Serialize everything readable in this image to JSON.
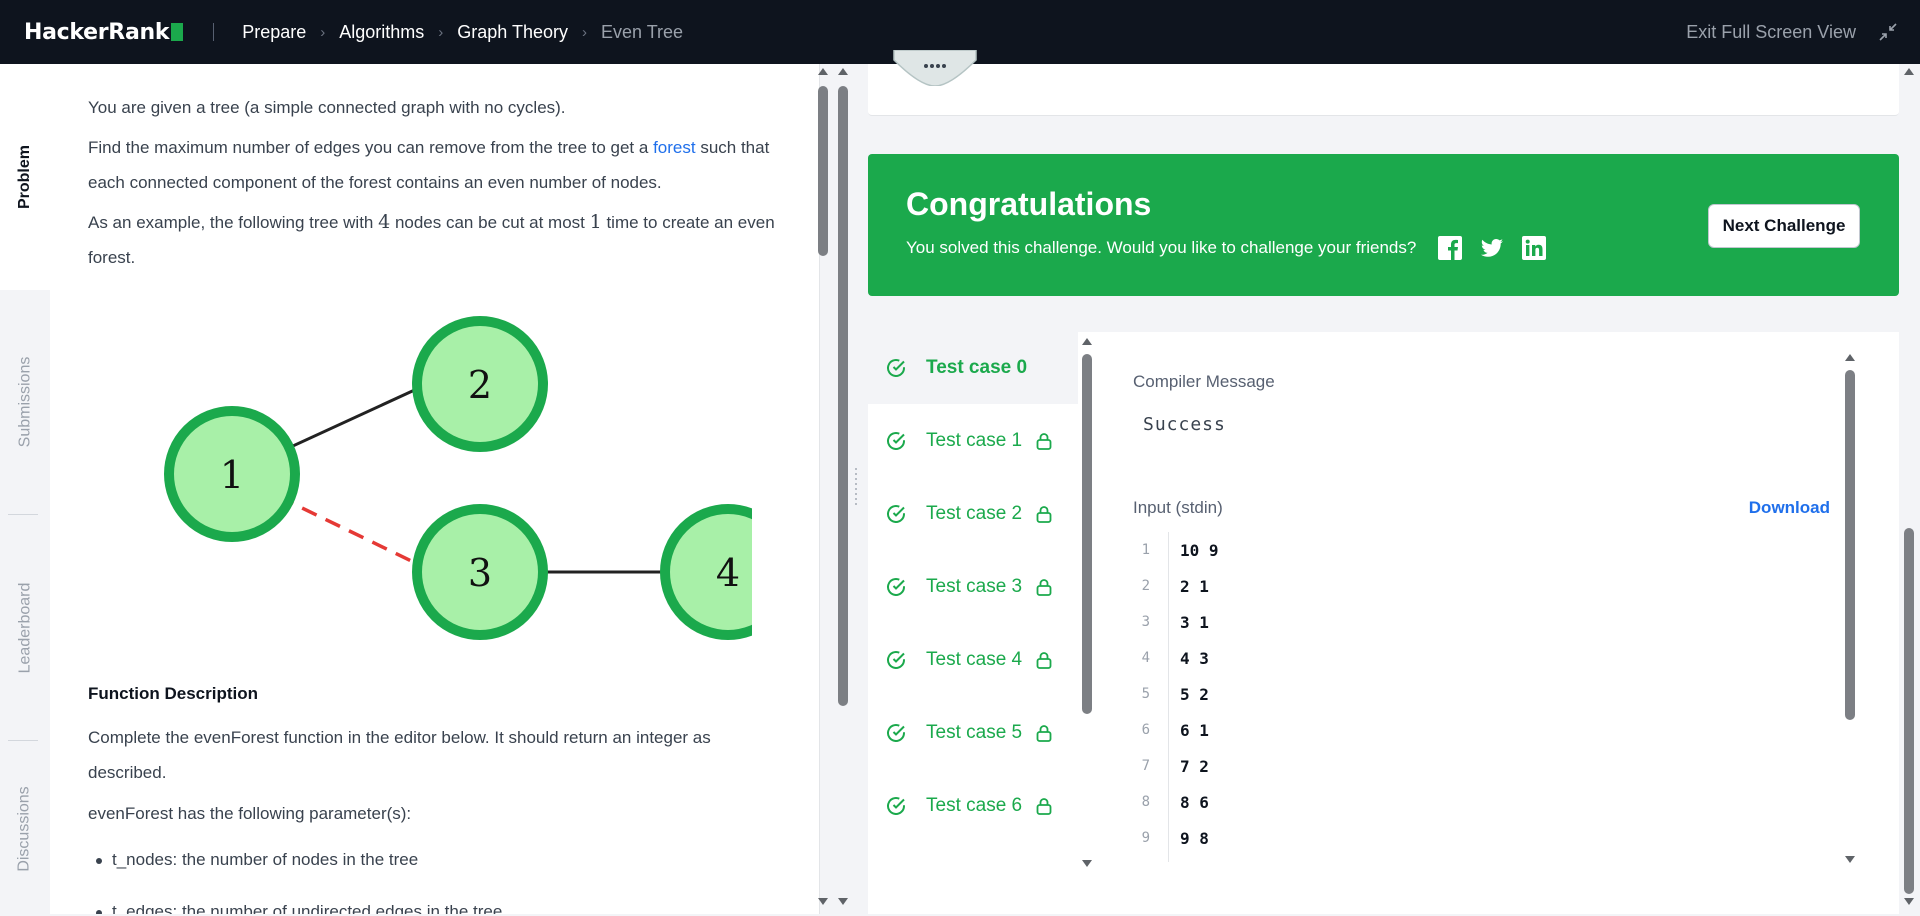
{
  "header": {
    "logo_text": "HackerRank",
    "breadcrumbs": [
      "Prepare",
      "Algorithms",
      "Graph Theory",
      "Even Tree"
    ],
    "exit_label": "Exit Full Screen View"
  },
  "tabs": [
    "Problem",
    "Submissions",
    "Leaderboard",
    "Discussions"
  ],
  "problem": {
    "intro": "You are given a tree (a simple connected graph with no cycles).",
    "p2_before": "Find the maximum number of edges you can remove from the tree to get a",
    "p2_link": "forest",
    "p2_after": "such that each connected component of the forest contains an even number of nodes.",
    "p3_a": "As an example, the following tree with",
    "p3_n1": "4",
    "p3_b": "nodes can be cut at most",
    "p3_n2": "1",
    "p3_c": "time to create an even forest.",
    "tree_nodes": [
      "1",
      "2",
      "3",
      "4"
    ],
    "fd_title": "Function Description",
    "fd_text": "Complete the evenForest function in the editor below. It should return an integer as described.",
    "params_intro": "evenForest has the following parameter(s):",
    "params": [
      "t_nodes: the number of nodes in the tree",
      "t_edges: the number of undirected edges in the tree"
    ]
  },
  "congrats": {
    "title": "Congratulations",
    "subtitle": "You solved this challenge. Would you like to challenge your friends?",
    "next_button": "Next Challenge",
    "share_icons": [
      "facebook-icon",
      "twitter-icon",
      "linkedin-icon"
    ]
  },
  "results": {
    "test_cases": [
      {
        "label": "Test case 0",
        "locked": false,
        "active": true
      },
      {
        "label": "Test case 1",
        "locked": true
      },
      {
        "label": "Test case 2",
        "locked": true
      },
      {
        "label": "Test case 3",
        "locked": true
      },
      {
        "label": "Test case 4",
        "locked": true
      },
      {
        "label": "Test case 5",
        "locked": true
      },
      {
        "label": "Test case 6",
        "locked": true
      }
    ],
    "compiler_label": "Compiler Message",
    "compiler_message": "Success",
    "input_label": "Input (stdin)",
    "download_label": "Download",
    "input_lines": [
      "10 9",
      "2 1",
      "3 1",
      "4 3",
      "5 2",
      "6 1",
      "7 2",
      "8 6",
      "9 8"
    ]
  },
  "colors": {
    "accent_green": "#1ba94c",
    "topbar": "#0e141e",
    "link_blue": "#1f6feb"
  }
}
